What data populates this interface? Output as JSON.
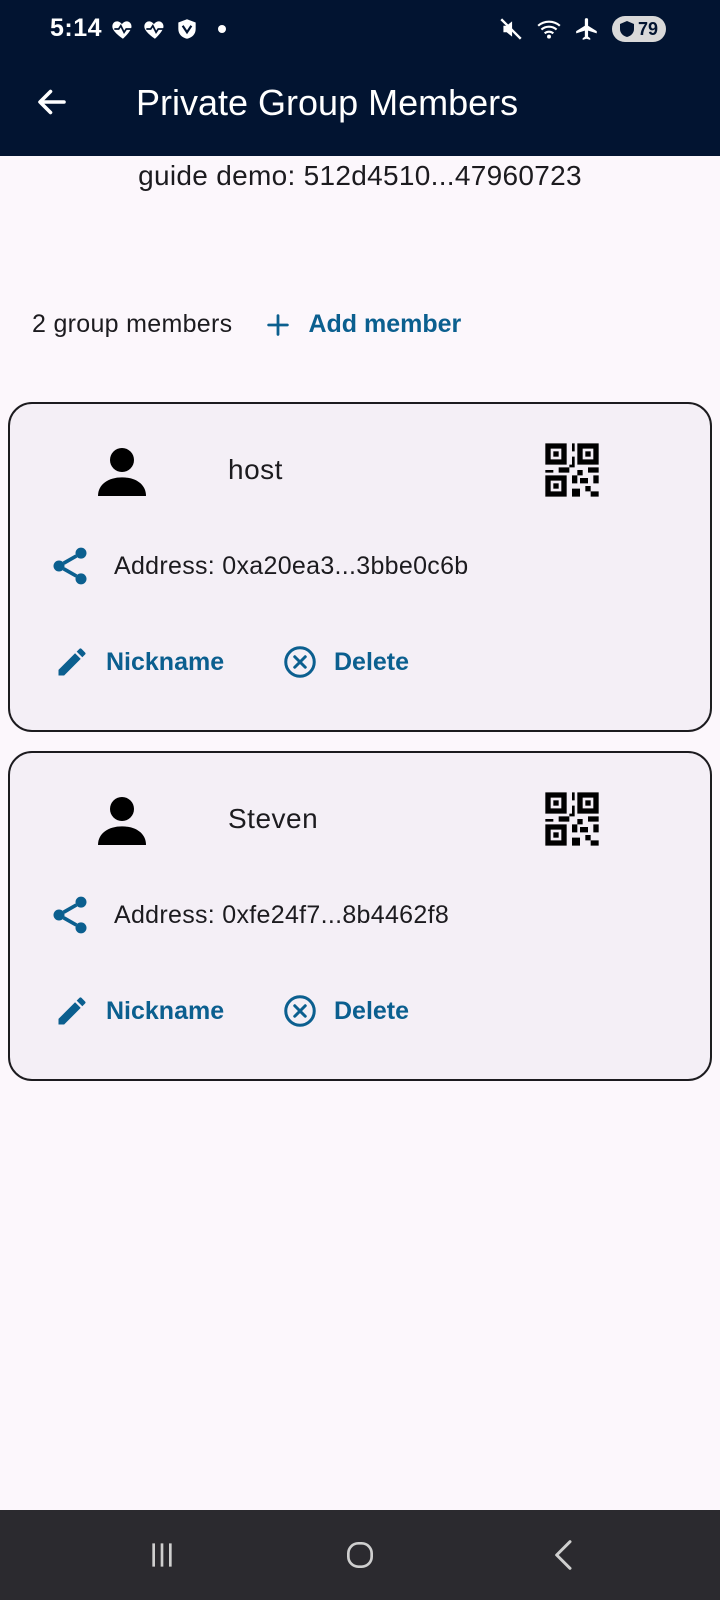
{
  "status_bar": {
    "time": "5:14",
    "battery_level": "79"
  },
  "header": {
    "title": "Private Group Members"
  },
  "group": {
    "label": "guide demo: 512d4510...47960723"
  },
  "members_summary": {
    "count_text": "2 group members",
    "add_member_label": "Add member"
  },
  "members": [
    {
      "name": "host",
      "address": "Address: 0xa20ea3...3bbe0c6b",
      "nickname_label": "Nickname",
      "delete_label": "Delete"
    },
    {
      "name": "Steven",
      "address": "Address: 0xfe24f7...8b4462f8",
      "nickname_label": "Nickname",
      "delete_label": "Delete"
    }
  ],
  "colors": {
    "app_bar": "#021431",
    "accent": "#0b5f8f",
    "card_bg": "#f4eff6",
    "page_bg": "#fcf7fc",
    "nav_bar": "#2b2a2f"
  },
  "icons": [
    "back-arrow-icon",
    "heart-pulse-icon",
    "shield-check-icon",
    "mute-icon",
    "wifi-icon",
    "airplane-icon",
    "person-icon",
    "qr-code-icon",
    "share-icon",
    "pencil-icon",
    "close-circle-icon",
    "plus-icon",
    "recent-apps-icon",
    "home-icon",
    "nav-back-icon"
  ]
}
